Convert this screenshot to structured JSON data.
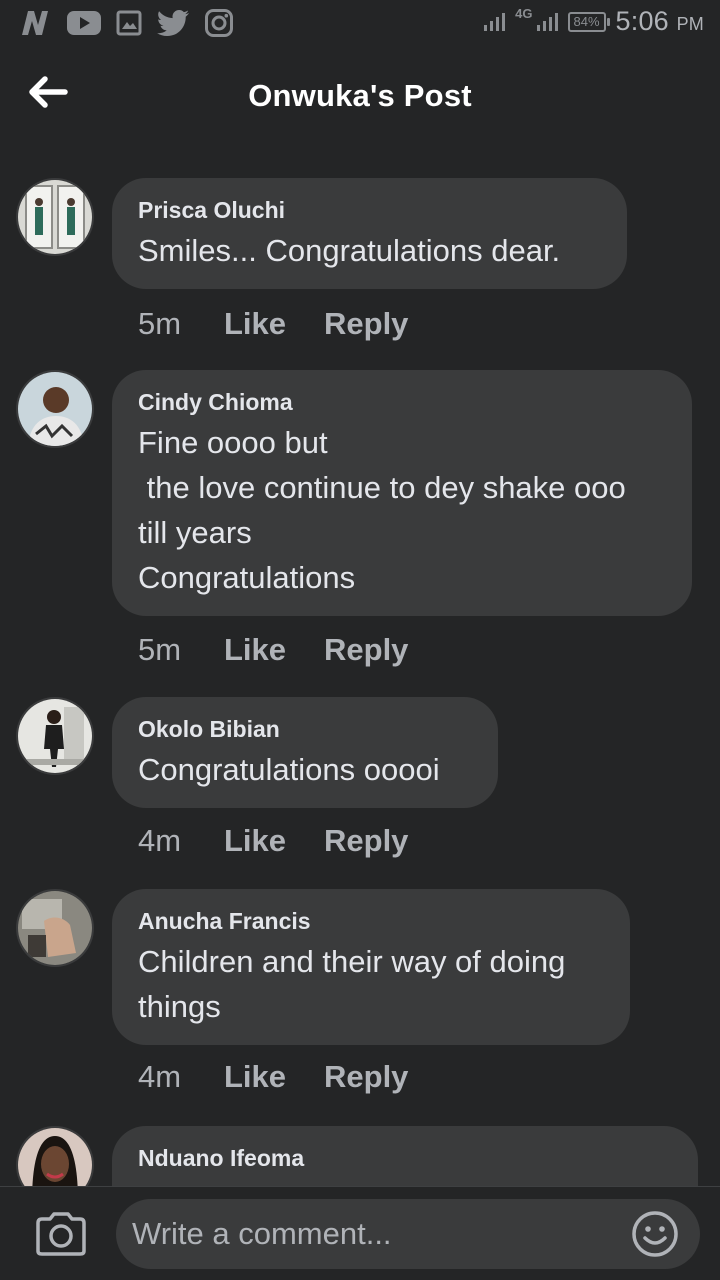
{
  "status_bar": {
    "app_icons": [
      "n-app-icon",
      "youtube-icon",
      "gallery-icon",
      "twitter-icon",
      "instagram-icon"
    ],
    "network_type": "4G",
    "battery": "84%",
    "time": "5:06",
    "time_suffix": "PM"
  },
  "header": {
    "title": "Onwuka's Post"
  },
  "comments": [
    {
      "author": "Prisca Oluchi",
      "text": "Smiles... Congratulations dear.",
      "time": "5m",
      "like_label": "Like",
      "reply_label": "Reply"
    },
    {
      "author": "Cindy Chioma",
      "text": "Fine oooo but\n the love continue to dey shake ooo\ntill years\nCongratulations",
      "time": "5m",
      "like_label": "Like",
      "reply_label": "Reply"
    },
    {
      "author": "Okolo Bibian",
      "text": "Congratulations ooooi",
      "time": "4m",
      "like_label": "Like",
      "reply_label": "Reply"
    },
    {
      "author": "Anucha Francis",
      "text": "Children and their way of doing\nthings",
      "time": "4m",
      "like_label": "Like",
      "reply_label": "Reply"
    },
    {
      "author": "Nduano Ifeoma",
      "text": ""
    }
  ],
  "composer": {
    "placeholder": "Write a comment..."
  },
  "colors": {
    "background": "#242526",
    "bubble": "#3a3b3c",
    "primary_text": "#e4e6eb",
    "secondary_text": "#b0b3b8"
  }
}
